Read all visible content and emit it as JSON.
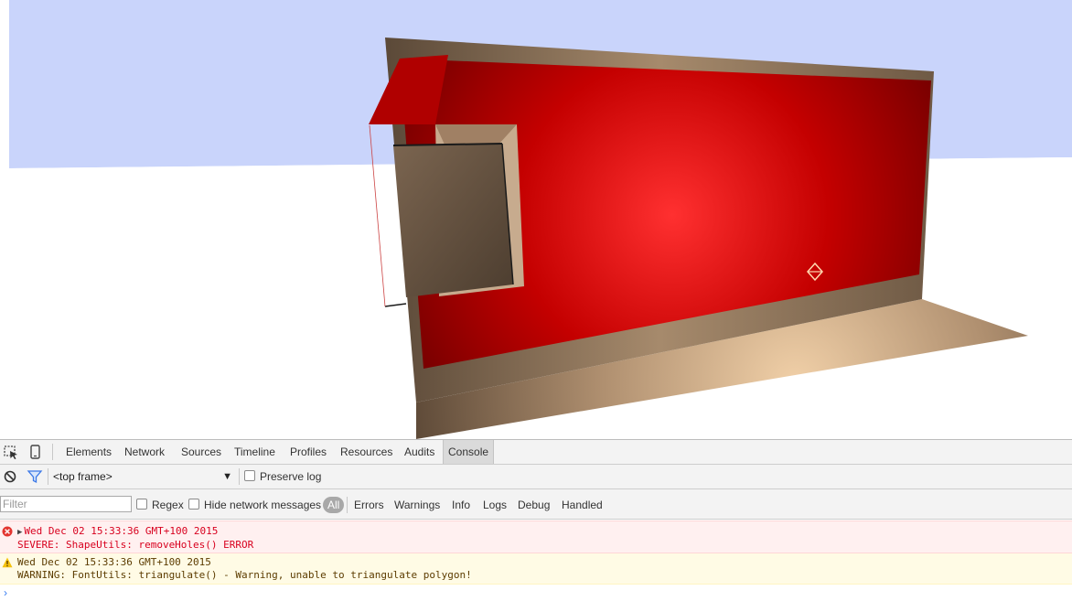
{
  "scene": {
    "sky_color": "#c9d4fb",
    "ground_color": "#ffffff",
    "wall_color": "#cc0000",
    "frame_color": "#a88b6e"
  },
  "devtools": {
    "tabs": [
      "Elements",
      "Network",
      "Sources",
      "Timeline",
      "Profiles",
      "Resources",
      "Audits",
      "Console"
    ],
    "selected_tab": "Console",
    "frame_select": "<top frame>",
    "preserve_log_label": "Preserve log",
    "filter_placeholder": "Filter",
    "regex_label": "Regex",
    "hide_network_label": "Hide network messages",
    "levels": [
      "All",
      "Errors",
      "Warnings",
      "Info",
      "Logs",
      "Debug",
      "Handled"
    ],
    "console": {
      "error_line1": "Wed Dec 02 15:33:36 GMT+100 2015",
      "error_line2": "SEVERE: ShapeUtils: removeHoles() ERROR",
      "warning_line1": "Wed Dec 02 15:33:36 GMT+100 2015",
      "warning_line2": "WARNING: FontUtils: triangulate() - Warning, unable to triangulate polygon!",
      "prompt_symbol": "›"
    },
    "icons": {
      "inspect": "inspect-element-icon",
      "device": "device-mode-icon",
      "clear": "clear-console-icon",
      "filter": "filter-icon",
      "error": "error-icon",
      "warning": "warning-icon"
    }
  }
}
